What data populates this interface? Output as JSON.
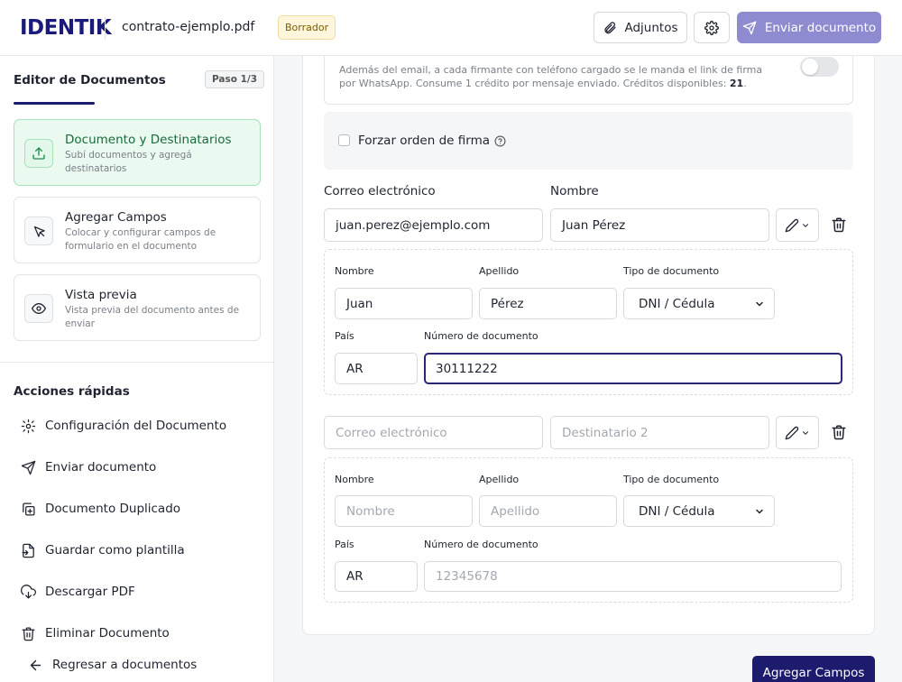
{
  "header": {
    "logo": "IDENTIK",
    "filename": "contrato-ejemplo.pdf",
    "status_badge": "Borrador",
    "attach_label": "Adjuntos",
    "send_label": "Enviar documento"
  },
  "sidebar": {
    "title": "Editor de Documentos",
    "step_badge": "Paso 1/3",
    "progress_fraction": 0.33,
    "steps": [
      {
        "title": "Documento y Destinatarios",
        "desc": "Subí documentos y agregá destinatarios",
        "icon": "upload-icon",
        "active": true
      },
      {
        "title": "Agregar Campos",
        "desc": "Colocar y configurar campos de formulario en el documento",
        "icon": "cursor-icon",
        "active": false
      },
      {
        "title": "Vista previa",
        "desc": "Vista previa del documento antes de enviar",
        "icon": "eye-icon",
        "active": false
      }
    ],
    "quick_actions_title": "Acciones rápidas",
    "quick_actions": [
      {
        "label": "Configuración del Documento",
        "icon": "gear-icon"
      },
      {
        "label": "Enviar documento",
        "icon": "send-icon"
      },
      {
        "label": "Documento Duplicado",
        "icon": "duplicate-icon"
      },
      {
        "label": "Guardar como plantilla",
        "icon": "save-template-icon"
      },
      {
        "label": "Descargar PDF",
        "icon": "download-icon"
      },
      {
        "label": "Eliminar Documento",
        "icon": "trash-icon"
      }
    ],
    "back_label": "Regresar a documentos"
  },
  "whatsapp": {
    "desc_prefix": "Además del email, a cada firmante con teléfono cargado se le manda el link de firma por WhatsApp. Consume 1 crédito por mensaje enviado. Créditos disponibles: ",
    "credits": "21",
    "desc_suffix": ".",
    "enabled": false
  },
  "signing_order": {
    "label": "Forzar orden de firma",
    "checked": false
  },
  "labels": {
    "email": "Correo electrónico",
    "name": "Nombre",
    "first_name": "Nombre",
    "last_name": "Apellido",
    "doc_type": "Tipo de documento",
    "country": "País",
    "doc_number": "Número de documento"
  },
  "recipients": [
    {
      "email": "juan.perez@ejemplo.com",
      "name": "Juan Pérez",
      "first_name": "Juan",
      "last_name": "Pérez",
      "doc_type": "DNI / Cédula",
      "country": "AR",
      "doc_number": "30111222"
    },
    {
      "email_placeholder": "Correo electrónico",
      "name_placeholder": "Destinatario 2",
      "first_name_placeholder": "Nombre",
      "last_name_placeholder": "Apellido",
      "doc_type": "DNI / Cédula",
      "country": "AR",
      "doc_number_placeholder": "12345678"
    }
  ],
  "footer": {
    "next_label": "Agregar Campos"
  },
  "colors": {
    "brand": "#1d1b6d",
    "send_button": "#8f8bd0",
    "active_step_bg": "#eafaf0"
  }
}
